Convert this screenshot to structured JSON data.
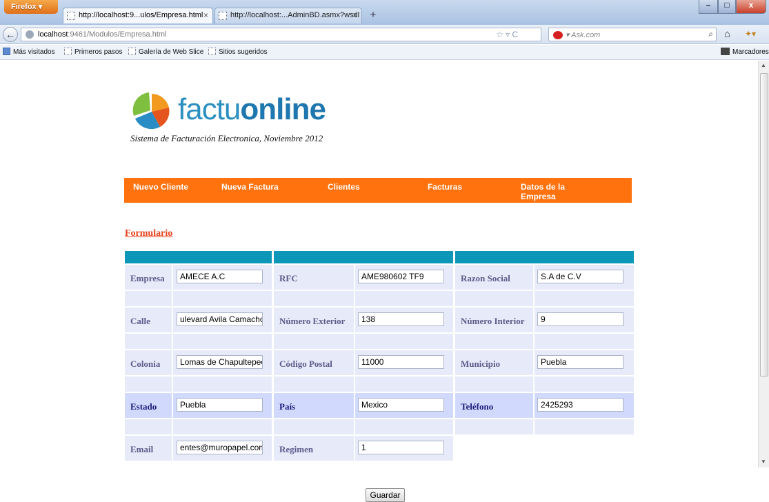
{
  "browser": {
    "menu_button": "Firefox",
    "tabs": [
      {
        "title": "http://localhost:9...ulos/Empresa.html",
        "active": true
      },
      {
        "title": "http://localhost:...AdminBD.asmx?wsdl",
        "active": false
      }
    ],
    "new_tab": "+",
    "url_host": "localhost",
    "url_rest": ":9461/Modulos/Empresa.html",
    "search_placeholder": "Ask.com",
    "bookmarks": [
      "Más visitados",
      "Primeros pasos",
      "Galería de Web Slice",
      "Sitios sugeridos"
    ],
    "bookmarks_menu": "Marcadores"
  },
  "page": {
    "logo_light": "factu",
    "logo_bold": "online",
    "tagline": "Sistema de Facturación Electronica, Noviembre 2012",
    "menu": [
      {
        "label": "Nuevo Cliente"
      },
      {
        "label": "Nueva Factura"
      },
      {
        "label": "Clientes"
      },
      {
        "label": "Facturas"
      },
      {
        "label": "Datos de la Empresa"
      }
    ],
    "form_title": "Formulario",
    "fields": {
      "empresa": {
        "label": "Empresa",
        "value": "AMECE A.C"
      },
      "rfc": {
        "label": "RFC",
        "value": "AME980602 TF9"
      },
      "razon_social": {
        "label": "Razon Social",
        "value": "S.A de C.V"
      },
      "calle": {
        "label": "Calle",
        "value": "ulevard Avila Camacho"
      },
      "numero_exterior": {
        "label": "Número Exterior",
        "value": "138"
      },
      "numero_interior": {
        "label": "Número Interior",
        "value": "9"
      },
      "colonia": {
        "label": "Colonia",
        "value": "Lomas de Chapultepec"
      },
      "codigo_postal": {
        "label": "Código Postal",
        "value": "11000"
      },
      "municipio": {
        "label": "Municipio",
        "value": "Puebla"
      },
      "estado": {
        "label": "Estado",
        "value": "Puebla"
      },
      "pais": {
        "label": "País",
        "value": "Mexico"
      },
      "telefono": {
        "label": "Teléfono",
        "value": "2425293"
      },
      "email": {
        "label": "Email",
        "value": "entes@muropapel.com"
      },
      "regimen": {
        "label": "Regimen",
        "value": "1"
      }
    },
    "save_button": "Guardar"
  },
  "colors": {
    "menu_bg": "#ff720d",
    "header_bar": "#0c97b8",
    "cell_bg": "#e6eaf9",
    "form_title": "#e8411b"
  }
}
